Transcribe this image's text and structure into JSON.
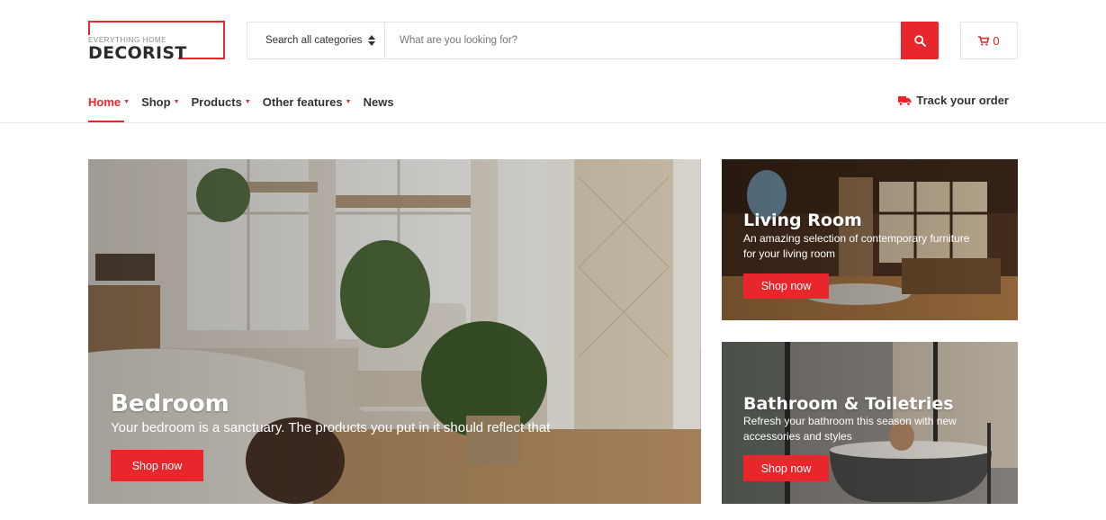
{
  "logo": {
    "tagline": "EVERYTHING HOME",
    "brand": "DECORIST"
  },
  "search": {
    "category_label": "Search all categories",
    "placeholder": "What are you looking for?"
  },
  "cart": {
    "count": "0"
  },
  "nav": {
    "items": [
      {
        "label": "Home",
        "has_dropdown": true,
        "active": true
      },
      {
        "label": "Shop",
        "has_dropdown": true
      },
      {
        "label": "Products",
        "has_dropdown": true
      },
      {
        "label": "Other features",
        "has_dropdown": true
      },
      {
        "label": "News",
        "has_dropdown": false
      }
    ],
    "track_order": "Track your order"
  },
  "banners": {
    "bedroom": {
      "title": "Bedroom",
      "subtitle": "Your bedroom is a sanctuary. The products you put in it should reflect that",
      "button": "Shop now"
    },
    "living": {
      "title": "Living Room",
      "subtitle_line1": "An amazing selection of contemporary furniture",
      "subtitle_line2": "for your living room",
      "button": "Shop now"
    },
    "bathroom": {
      "title": "Bathroom & Toiletries",
      "subtitle_line1": "Refresh your bathroom this season with new",
      "subtitle_line2": "accessories and styles",
      "button": "Shop now"
    }
  },
  "colors": {
    "accent": "#e8262b",
    "text": "#333333",
    "border": "#e3e3e3"
  },
  "icons": {
    "search": "search-icon",
    "cart": "cart-icon",
    "truck": "truck-icon",
    "select_arrows": "sort-arrows-icon"
  }
}
